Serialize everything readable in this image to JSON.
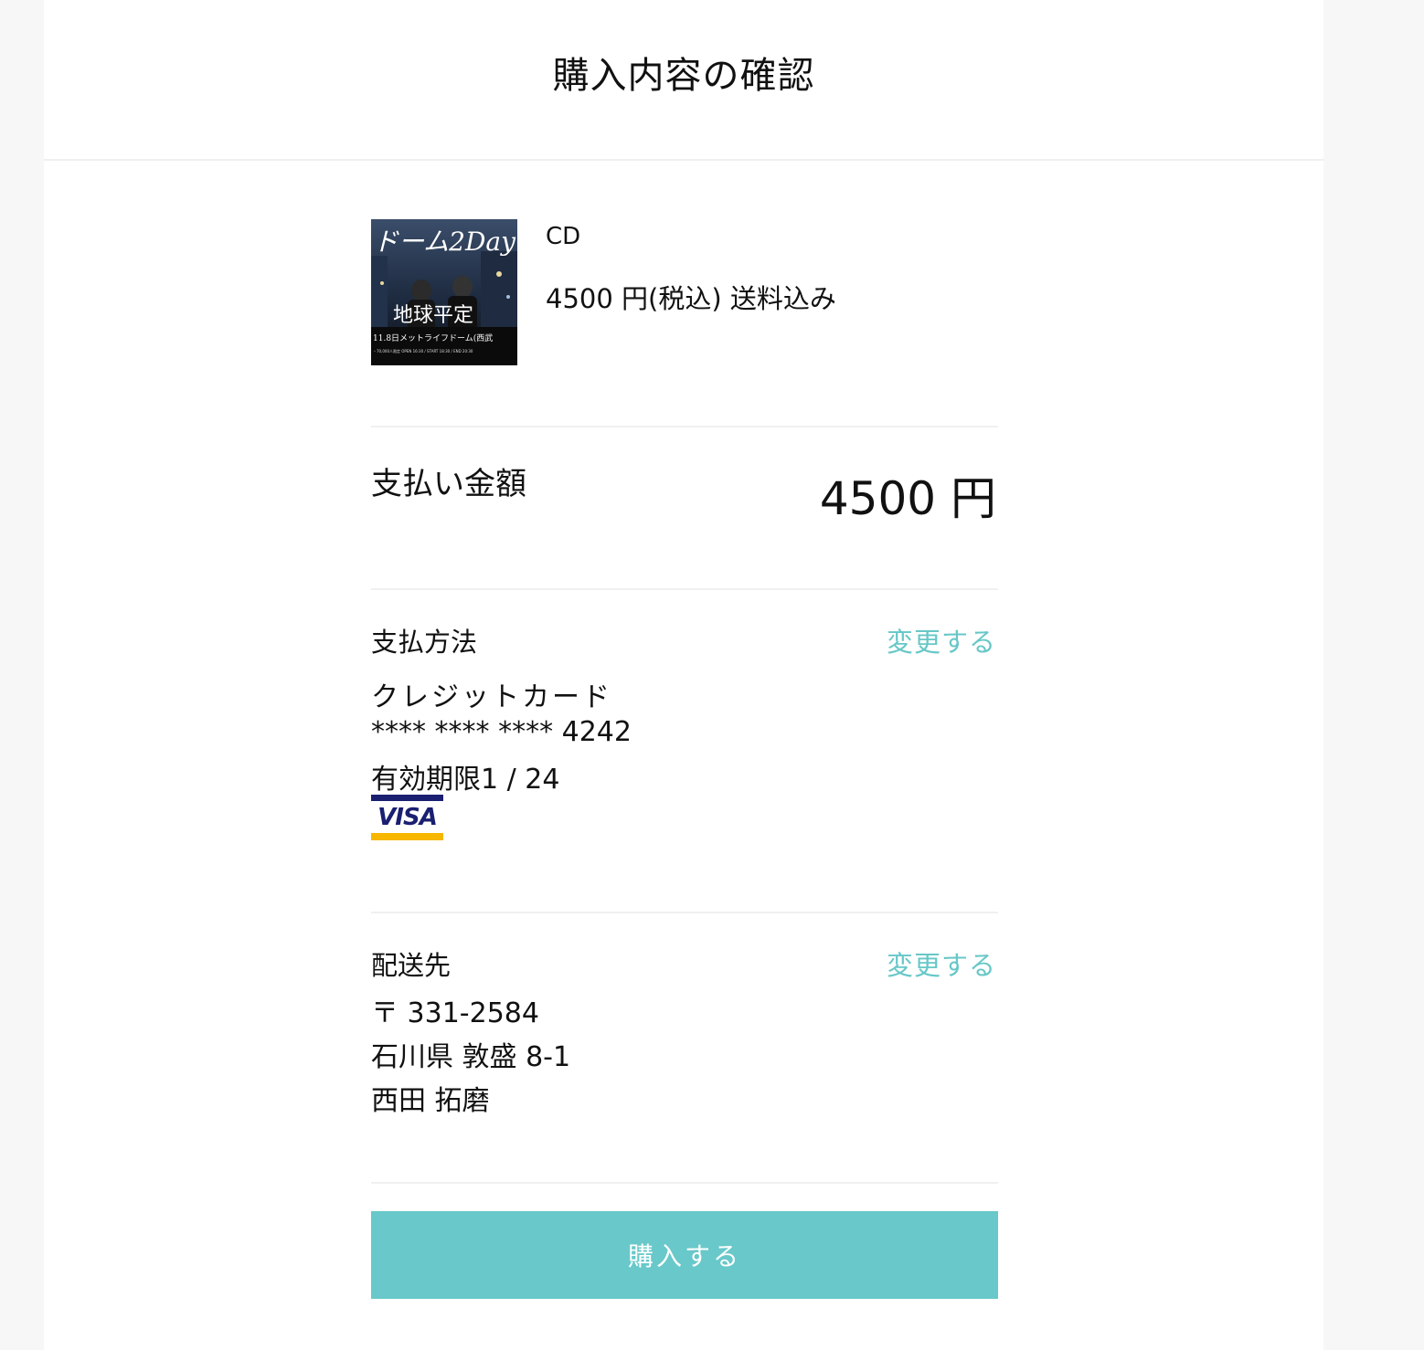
{
  "header": {
    "title": "購入内容の確認"
  },
  "product": {
    "name": "CD",
    "price": "4500 円(税込) 送料込み",
    "thumbnail_text": {
      "title": "ドーム2Day",
      "subtitle": "地球平定",
      "line1": "11.8日メットライフドーム(西武",
      "line2": "・70,000人限定 OPEN 16:30 / START 18:30 / END 20:30"
    }
  },
  "total": {
    "label": "支払い金額",
    "value": "4500 円"
  },
  "payment": {
    "label": "支払方法",
    "change_label": "変更する",
    "method": "クレジットカード",
    "card_number": "**** **** **** 4242",
    "expiry": "有効期限1 / 24",
    "brand": "VISA"
  },
  "shipping": {
    "label": "配送先",
    "change_label": "変更する",
    "postal": "〒 331-2584",
    "address": "石川県 敦盛 8-1",
    "name": "西田 拓磨"
  },
  "actions": {
    "buy_label": "購入する"
  },
  "colors": {
    "accent": "#67c7c7",
    "button": "#68c8ca",
    "visa_blue": "#1a1f71",
    "visa_gold": "#f7b600"
  }
}
